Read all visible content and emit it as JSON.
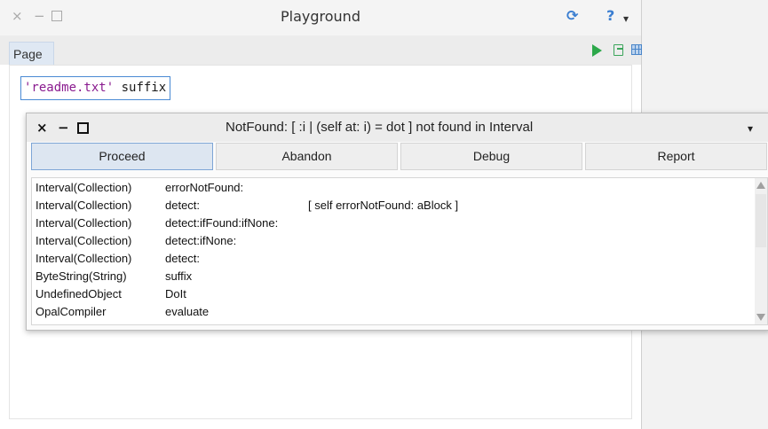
{
  "playground": {
    "title": "Playground",
    "close_glyph": "×",
    "minimize_glyph": "−",
    "sync_glyph": "⟳",
    "help_glyph": "?",
    "menu_glyph": "▾",
    "tab_label": "Page",
    "code_string": "'readme.txt'",
    "code_selector": " suffix",
    "toolbar_icons": [
      "play-icon",
      "export-icon",
      "grid-icon"
    ]
  },
  "debugger": {
    "title": "NotFound: [ :i | (self at: i) = dot ] not found in Interval",
    "close_glyph": "×",
    "minimize_glyph": "−",
    "menu_glyph": "▾",
    "buttons": [
      "Proceed",
      "Abandon",
      "Debug",
      "Report"
    ],
    "stack": [
      {
        "cls": "Interval(Collection)",
        "method": "errorNotFound:",
        "src": ""
      },
      {
        "cls": "Interval(Collection)",
        "method": "detect:",
        "src": "[ self errorNotFound: aBlock ]"
      },
      {
        "cls": "Interval(Collection)",
        "method": "detect:ifFound:ifNone:",
        "src": ""
      },
      {
        "cls": "Interval(Collection)",
        "method": "detect:ifNone:",
        "src": ""
      },
      {
        "cls": "Interval(Collection)",
        "method": "detect:",
        "src": ""
      },
      {
        "cls": "ByteString(String)",
        "method": "suffix",
        "src": ""
      },
      {
        "cls": "UndefinedObject",
        "method": "DoIt",
        "src": ""
      },
      {
        "cls": "OpalCompiler",
        "method": "evaluate",
        "src": ""
      }
    ]
  },
  "colors": {
    "accent_blue": "#3a7ed1",
    "play_green": "#2ca84a",
    "string_purple": "#8a1b8f"
  }
}
